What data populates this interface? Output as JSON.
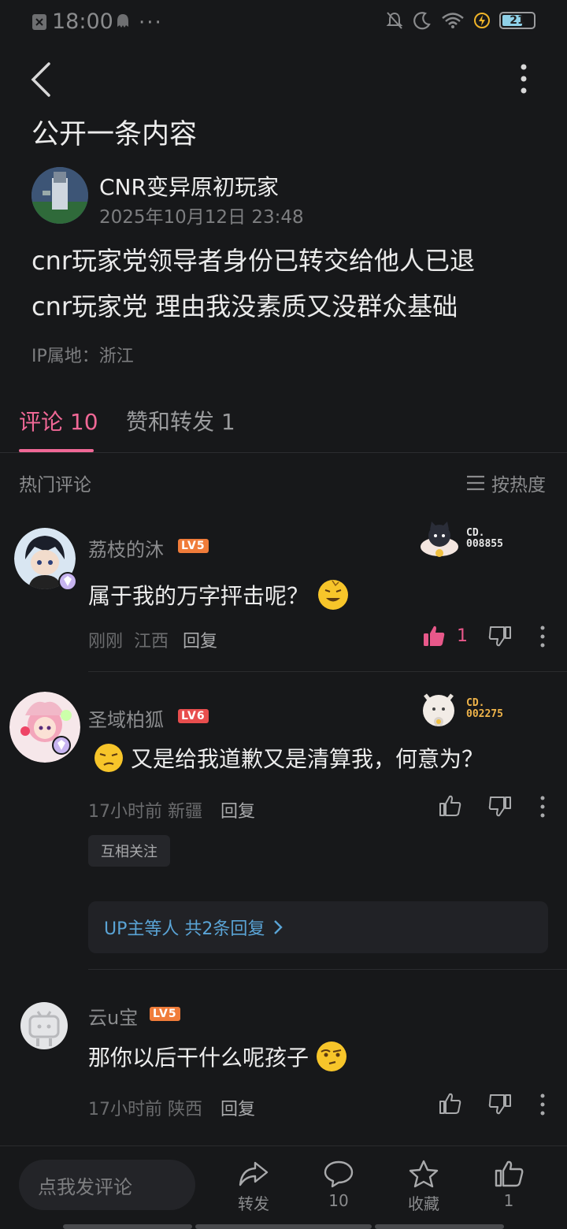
{
  "status_bar": {
    "time": "18:00",
    "battery": "21"
  },
  "header": {
    "title": "公开一条内容"
  },
  "post": {
    "author": "CNR变异原初玩家",
    "time": "2025年10月12日 23:48",
    "body_line1": "cnr玩家党领导者身份已转交给他人已退",
    "body_line2": "cnr玩家党 理由我没素质又没群众基础",
    "ip": "IP属地：浙江"
  },
  "tabs": [
    {
      "label": "评论 10"
    },
    {
      "label": "赞和转发 1"
    }
  ],
  "comments_header": {
    "hot_label": "热门评论",
    "sort_label": "按热度"
  },
  "comments": [
    {
      "name": "荔枝的沐",
      "level": "LV5",
      "level_color": "#f07c3a",
      "badge_line1": "CD.",
      "badge_line2": "008855",
      "badge_color": "#e8e8e8",
      "text": "属于我的万字抨击呢？",
      "time": "刚刚",
      "location": "江西",
      "reply_label": "回复",
      "like_count": "1"
    },
    {
      "name": "圣域柏狐",
      "level": "LV6",
      "level_color": "#e84e4e",
      "badge_line1": "CD.",
      "badge_line2": "002275",
      "badge_color": "#f0b44a",
      "text": "又是给我道歉又是清算我，何意为？",
      "time": "17小时前",
      "location": "新疆",
      "reply_label": "回复",
      "mutual_label": "互相关注",
      "sub_replies": "UP主等人 共2条回复"
    },
    {
      "name": "云u宝",
      "level": "LV5",
      "level_color": "#f07c3a",
      "text": "那你以后干什么呢孩子",
      "time": "17小时前",
      "location": "陕西",
      "reply_label": "回复"
    }
  ],
  "bottom_bar": {
    "input_placeholder": "点我发评论",
    "share_label": "转发",
    "comment_count": "10",
    "favorite_label": "收藏",
    "like_count": "1"
  },
  "colors": {
    "accent": "#f06896",
    "link": "#5aa4d6",
    "background": "#17181a"
  }
}
